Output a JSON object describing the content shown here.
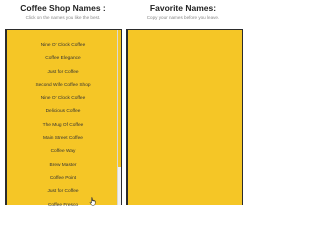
{
  "left_column": {
    "title": "Coffee Shop Names :",
    "subtitle": "Click on the names you like the best.",
    "names": [
      "Nine O' Clock Coffee",
      "Coffee Elegance",
      "Just for Coffee",
      "Second Wife Coffee Shop",
      "Nine O' Clock Coffee",
      "Delicious Coffee",
      "The Mug Of Coffee",
      "Main Street Coffee",
      "Coffee Way",
      "Brew Master",
      "Coffee Point",
      "Just for Coffee",
      "Coffee Fresco"
    ]
  },
  "right_column": {
    "title": "Favorite Names:",
    "subtitle": "Copy your names before you leave."
  },
  "colors": {
    "panel_bg": "#f5c626",
    "panel_border": "#2b2b2b"
  },
  "icons": {
    "cursor": "hand-pointer-icon"
  }
}
